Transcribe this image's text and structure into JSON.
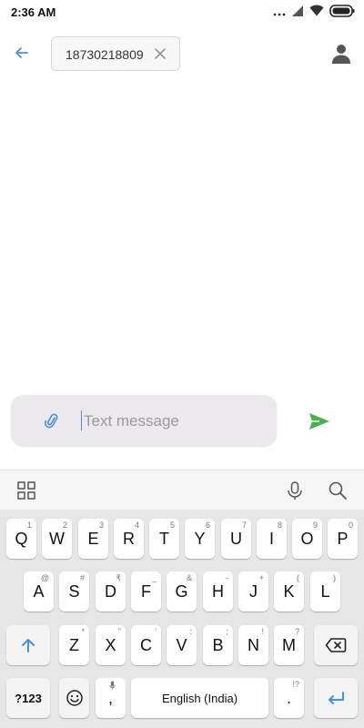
{
  "status_bar": {
    "time": "2:36 AM"
  },
  "header": {
    "recipient": "18730218809"
  },
  "compose": {
    "placeholder": "Text message"
  },
  "keyboard": {
    "row1": [
      {
        "key": "Q",
        "hint": "1"
      },
      {
        "key": "W",
        "hint": "2"
      },
      {
        "key": "E",
        "hint": "3"
      },
      {
        "key": "R",
        "hint": "4"
      },
      {
        "key": "T",
        "hint": "5"
      },
      {
        "key": "Y",
        "hint": "6"
      },
      {
        "key": "U",
        "hint": "7"
      },
      {
        "key": "I",
        "hint": "8"
      },
      {
        "key": "O",
        "hint": "9"
      },
      {
        "key": "P",
        "hint": "0"
      }
    ],
    "row2": [
      {
        "key": "A",
        "hint": "@"
      },
      {
        "key": "S",
        "hint": "#"
      },
      {
        "key": "D",
        "hint": "₹"
      },
      {
        "key": "F",
        "hint": "_"
      },
      {
        "key": "G",
        "hint": "&"
      },
      {
        "key": "H",
        "hint": "-"
      },
      {
        "key": "J",
        "hint": "+"
      },
      {
        "key": "K",
        "hint": "("
      },
      {
        "key": "L",
        "hint": ")"
      }
    ],
    "row3": [
      {
        "key": "Z",
        "hint": "*"
      },
      {
        "key": "X",
        "hint": "\""
      },
      {
        "key": "C",
        "hint": "'"
      },
      {
        "key": "V",
        "hint": ":"
      },
      {
        "key": "B",
        "hint": ";"
      },
      {
        "key": "N",
        "hint": "!"
      },
      {
        "key": "M",
        "hint": "?"
      }
    ],
    "symbols_label": "?123",
    "comma": ",",
    "space_label": "English (India)",
    "period": ".",
    "period_hint": "!?"
  },
  "colors": {
    "accent": "#4a90d9",
    "send": "#4caf50"
  }
}
